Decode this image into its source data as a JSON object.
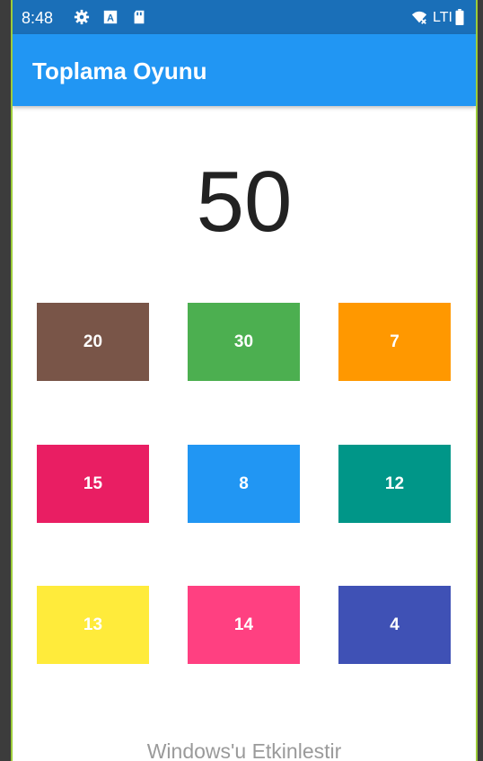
{
  "status_bar": {
    "time": "8:48",
    "network_label": "LTI",
    "icons": [
      "gear-icon",
      "a-box-icon",
      "sd-card-icon",
      "wifi-off-icon",
      "battery-icon"
    ]
  },
  "app_bar": {
    "title": "Toplama Oyunu",
    "color": "#2196f3"
  },
  "game": {
    "target": "50",
    "tiles": [
      {
        "label": "20",
        "color": "#795548"
      },
      {
        "label": "30",
        "color": "#4caf50"
      },
      {
        "label": "7",
        "color": "#ff9800"
      },
      {
        "label": "15",
        "color": "#e91e63"
      },
      {
        "label": "8",
        "color": "#2196f3"
      },
      {
        "label": "12",
        "color": "#009688"
      },
      {
        "label": "13",
        "color": "#ffeb3b"
      },
      {
        "label": "14",
        "color": "#ff4081"
      },
      {
        "label": "4",
        "color": "#3f51b5"
      }
    ]
  },
  "watermark": "Windows'u Etkinlestir"
}
